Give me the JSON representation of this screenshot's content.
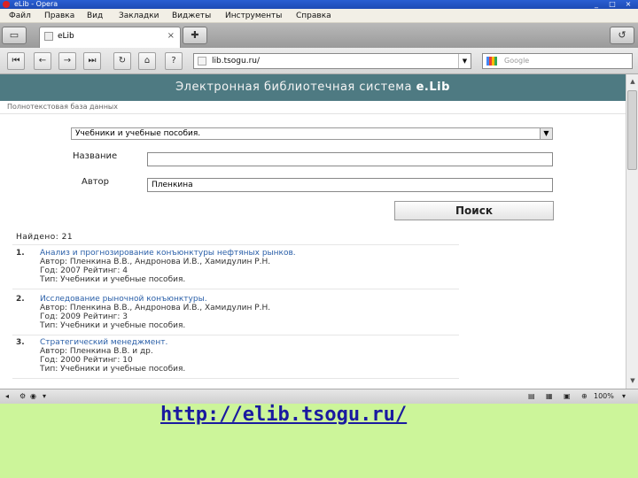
{
  "browser": {
    "title": "eLib - Opera",
    "menu": [
      "Файл",
      "Правка",
      "Вид",
      "Закладки",
      "Виджеты",
      "Инструменты",
      "Справка"
    ],
    "tab_label": "eLib",
    "address": "lib.tsogu.ru/",
    "search_placeholder": "Google",
    "zoom": "100%"
  },
  "site": {
    "header_prefix": "Электронная библиотечная система",
    "header_brand": "e.Lib",
    "breadcrumb": "Полнотекстовая база данных"
  },
  "form": {
    "category": "Учебники и учебные пособия.",
    "title_label": "Название",
    "title_value": "",
    "author_label": "Автор",
    "author_value": "Пленкина",
    "search_button": "Поиск"
  },
  "results": {
    "found": "Найдено: 21",
    "items": [
      {
        "num": "1.",
        "title": "Анализ и прогнозирование конъюнктуры нефтяных рынков.",
        "authors": "Автор: Пленкина В.В., Андронова И.В., Хамидулин Р.Н.",
        "meta": "Год: 2007 Рейтинг: 4",
        "type": "Тип: Учебники и учебные пособия."
      },
      {
        "num": "2.",
        "title": "Исследование рыночной конъюнктуры.",
        "authors": "Автор: Пленкина В.В., Андронова И.В., Хамидулин Р.Н.",
        "meta": "Год: 2009 Рейтинг: 3",
        "type": "Тип: Учебники и учебные пособия."
      },
      {
        "num": "3.",
        "title": "Стратегический менеджмент.",
        "authors": "Автор: Пленкина В.В. и др.",
        "meta": "Год: 2000 Рейтинг: 10",
        "type": "Тип: Учебники и учебные пособия."
      }
    ]
  },
  "caption": "http://elib.tsogu.ru/"
}
